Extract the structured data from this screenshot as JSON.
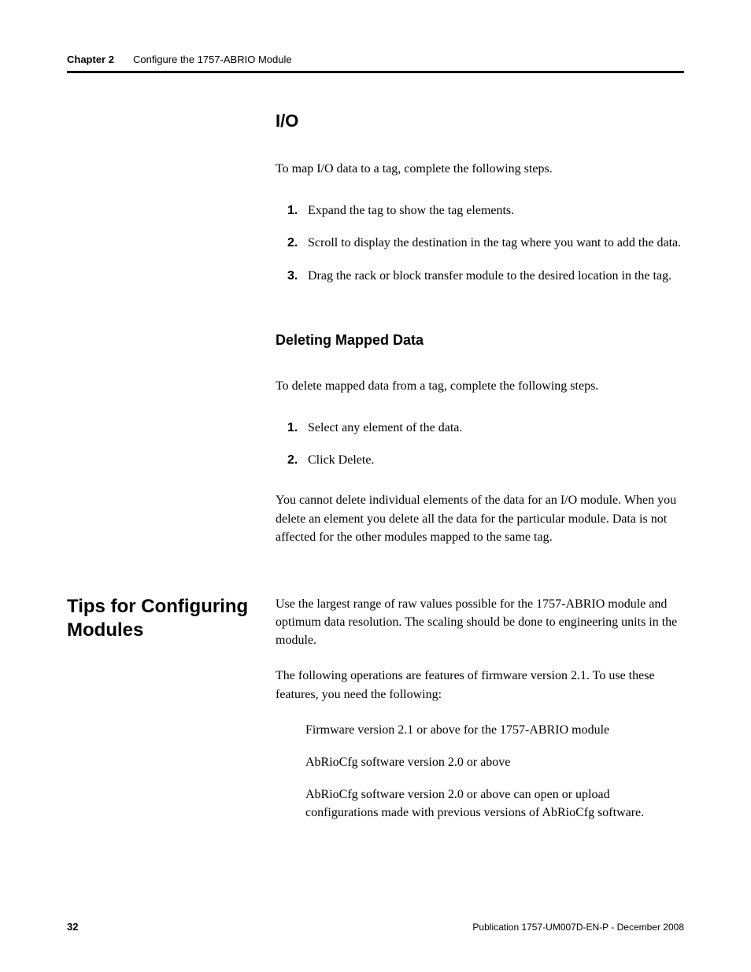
{
  "header": {
    "chapter_label": "Chapter 2",
    "chapter_title": "Configure the 1757-ABRIO Module"
  },
  "section_io": {
    "heading": "I/O",
    "intro": "To map I/O data to a tag, complete the following steps.",
    "steps": [
      "Expand the tag to show the tag elements.",
      "Scroll to display the destination in the tag where you want to add the data.",
      "Drag the rack or block transfer module to the desired location in the tag."
    ]
  },
  "section_delete": {
    "heading": "Deleting Mapped Data",
    "intro": "To delete mapped data from a tag, complete the following steps.",
    "steps": [
      "Select any element of the data.",
      "Click Delete."
    ],
    "note": "You cannot delete individual elements of the data for an I/O module. When you delete an element you delete all the data for the particular module. Data is not affected for the other modules mapped to the same tag."
  },
  "section_tips": {
    "sidebar_heading": "Tips for Configuring Modules",
    "p1": "Use the largest range of raw values possible for the 1757-ABRIO module and optimum data resolution. The scaling should be done to engineering units in the module.",
    "p2": "The following operations are features of firmware version 2.1. To use these features, you need the following:",
    "bullets": [
      "Firmware version 2.1 or above for the 1757-ABRIO module",
      "AbRioCfg software version 2.0 or above",
      "AbRioCfg software version 2.0 or above can open or upload configurations made with previous versions of AbRioCfg software."
    ]
  },
  "footer": {
    "page_number": "32",
    "publication": "Publication 1757-UM007D-EN-P - December 2008"
  },
  "nums": {
    "n1": "1.",
    "n2": "2.",
    "n3": "3."
  }
}
